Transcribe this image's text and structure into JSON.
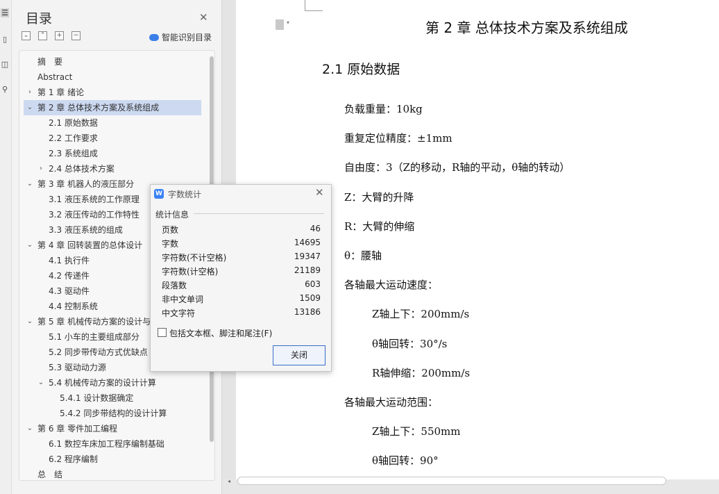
{
  "toc": {
    "title": "目录",
    "smart_label": "智能识别目录",
    "tool_icons": [
      "collapse-all-icon",
      "expand-up-icon",
      "add-icon",
      "remove-icon"
    ],
    "items": [
      {
        "label": "摘　要",
        "level": 0,
        "chevron": "",
        "selected": false
      },
      {
        "label": "Abstract",
        "level": 0,
        "chevron": "",
        "selected": false
      },
      {
        "label": "第 1 章  绪论",
        "level": 0,
        "chevron": "›",
        "selected": false
      },
      {
        "label": "第 2 章  总体技术方案及系统组成",
        "level": 0,
        "chevron": "⌄",
        "selected": true
      },
      {
        "label": "2.1 原始数据",
        "level": 1,
        "chevron": "",
        "selected": false
      },
      {
        "label": "2.2 工作要求",
        "level": 1,
        "chevron": "",
        "selected": false
      },
      {
        "label": "2.3 系统组成",
        "level": 1,
        "chevron": "",
        "selected": false
      },
      {
        "label": "2.4 总体技术方案",
        "level": 1,
        "chevron": "›",
        "selected": false
      },
      {
        "label": "第 3 章  机器人的液压部分",
        "level": 0,
        "chevron": "⌄",
        "selected": false
      },
      {
        "label": "3.1 液压系统的工作原理",
        "level": 1,
        "chevron": "",
        "selected": false
      },
      {
        "label": "3.2 液压传动的工作特性",
        "level": 1,
        "chevron": "",
        "selected": false
      },
      {
        "label": "3.3 液压系统的组成",
        "level": 1,
        "chevron": "",
        "selected": false
      },
      {
        "label": "第 4 章  回转装置的总体设计",
        "level": 0,
        "chevron": "⌄",
        "selected": false
      },
      {
        "label": "4.1 执行件",
        "level": 1,
        "chevron": "",
        "selected": false
      },
      {
        "label": "4.2 传递件",
        "level": 1,
        "chevron": "",
        "selected": false
      },
      {
        "label": "4.3 驱动件",
        "level": 1,
        "chevron": "",
        "selected": false
      },
      {
        "label": "4.4 控制系统",
        "level": 1,
        "chevron": "",
        "selected": false
      },
      {
        "label": "第 5 章  机械传动方案的设计与",
        "level": 0,
        "chevron": "⌄",
        "selected": false
      },
      {
        "label": "5.1 小车的主要组成部分",
        "level": 1,
        "chevron": "",
        "selected": false
      },
      {
        "label": "5.2 同步带传动方式优缺点",
        "level": 1,
        "chevron": "",
        "selected": false
      },
      {
        "label": "5.3 驱动动力源",
        "level": 1,
        "chevron": "",
        "selected": false
      },
      {
        "label": "5.4 机械传动方案的设计计算",
        "level": 1,
        "chevron": "⌄",
        "selected": false
      },
      {
        "label": "5.4.1 设计数据确定",
        "level": 2,
        "chevron": "",
        "selected": false
      },
      {
        "label": "5.4.2 同步带结构的设计计算",
        "level": 2,
        "chevron": "",
        "selected": false
      },
      {
        "label": "第 6 章  零件加工编程",
        "level": 0,
        "chevron": "⌄",
        "selected": false
      },
      {
        "label": "6.1 数控车床加工程序编制基础",
        "level": 1,
        "chevron": "",
        "selected": false
      },
      {
        "label": "6.2 程序编制",
        "level": 1,
        "chevron": "",
        "selected": false
      },
      {
        "label": "总　结",
        "level": 0,
        "chevron": "",
        "selected": false
      }
    ]
  },
  "doc": {
    "chapter_title": "第 2 章  总体技术方案及系统组成",
    "section_title": "2.1 原始数据",
    "paragraphs": [
      {
        "text": "负载重量：10kg",
        "indent": 0
      },
      {
        "text": "重复定位精度：±1mm",
        "indent": 0
      },
      {
        "text": "自由度：3（Z的移动，R轴的平动，θ轴的转动）",
        "indent": 0
      },
      {
        "text": "Z：大臂的升降",
        "indent": 0
      },
      {
        "text": "R：大臂的伸缩",
        "indent": 0
      },
      {
        "text": "θ：腰轴",
        "indent": 0
      },
      {
        "text": "各轴最大运动速度：",
        "indent": 0
      },
      {
        "text": "Z轴上下：200mm/s",
        "indent": 1
      },
      {
        "text": "θ轴回转：30°/s",
        "indent": 1
      },
      {
        "text": "R轴伸缩：200mm/s",
        "indent": 1
      },
      {
        "text": "各轴最大运动范围：",
        "indent": 0
      },
      {
        "text": "Z轴上下：550mm",
        "indent": 1
      },
      {
        "text": "θ轴回转：90°",
        "indent": 1
      }
    ]
  },
  "dialog": {
    "title": "字数统计",
    "section": "统计信息",
    "rows": [
      {
        "label": "页数",
        "value": "46"
      },
      {
        "label": "字数",
        "value": "14695"
      },
      {
        "label": "字符数(不计空格)",
        "value": "19347"
      },
      {
        "label": "字符数(计空格)",
        "value": "21189"
      },
      {
        "label": "段落数",
        "value": "603"
      },
      {
        "label": "非中文单词",
        "value": "1509"
      },
      {
        "label": "中文字符",
        "value": "13186"
      }
    ],
    "checkbox_label": "包括文本框、脚注和尾注(F)",
    "checkbox_checked": false,
    "close_button": "关闭",
    "logo_letter": "W"
  },
  "colors": {
    "selected_bg": "#ccd9f1",
    "accent": "#3a6ec7"
  }
}
